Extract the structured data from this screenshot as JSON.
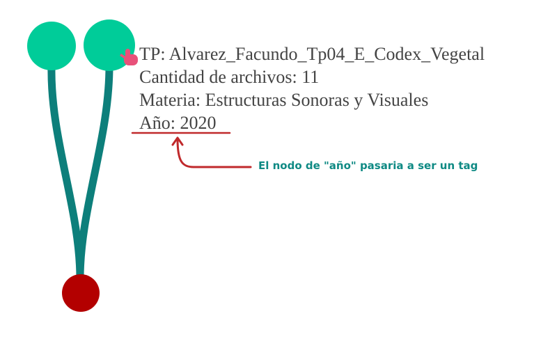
{
  "info": {
    "tp": "TP: Alvarez_Facundo_Tp04_E_Codex_Vegetal",
    "cantidad": "Cantidad de archivos: 11",
    "materia": "Materia: Estructuras Sonoras y Visuales",
    "anio": "Año: 2020"
  },
  "annotation": {
    "note": "El nodo de \"año\" pasaria a ser un tag"
  },
  "colors": {
    "node_green": "#00cc99",
    "node_red": "#b30000",
    "edge_teal": "#0d7f7b",
    "annotation_red": "#c0292b",
    "annotation_teal": "#0f8a84",
    "cursor_pink": "#e8517a"
  },
  "icons": {
    "cursor": "hand-pointer-icon"
  }
}
